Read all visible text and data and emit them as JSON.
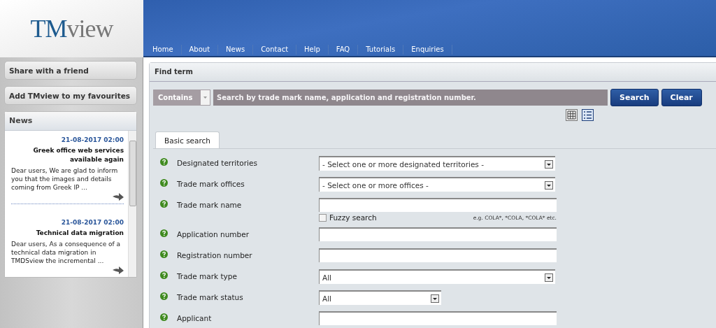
{
  "logo": {
    "part_1": "TM",
    "part_2": "view"
  },
  "nav": [
    "Home",
    "About",
    "News",
    "Contact",
    "Help",
    "FAQ",
    "Tutorials",
    "Enquiries"
  ],
  "sidebar": {
    "buttons": [
      "Share with a friend",
      "Add TMview to my favourites"
    ],
    "news": {
      "title": "News",
      "items": [
        {
          "date": "21-08-2017 02:00",
          "headline": "Greek office web services available again",
          "body": "Dear users, We are glad to inform you that the images and details coming from Greek IP ..."
        },
        {
          "date": "21-08-2017 02:00",
          "headline": "Technical data migration",
          "body": "Dear users, As a consequence of a technical data migration in TMDSview the incremental ..."
        }
      ]
    }
  },
  "find": {
    "title": "Find term",
    "mode": "Contains",
    "placeholder": "Search by trade mark name, application and registration number.",
    "buttons": [
      "Search",
      "Clear"
    ],
    "views": [
      {
        "kind": "grid",
        "selected": false
      },
      {
        "kind": "list",
        "selected": true
      }
    ]
  },
  "tabs": [
    {
      "label": "Basic search",
      "selected": true
    }
  ],
  "fields": [
    {
      "label": "Designated territories",
      "kind": "select",
      "value": "- Select one or more designated territories -"
    },
    {
      "label": "Trade mark offices",
      "kind": "select",
      "value": "- Select one or more offices -"
    },
    {
      "label": "Trade mark name",
      "kind": "text",
      "fuzzy": {
        "label": "Fuzzy search",
        "checked": false
      },
      "hint": "e.g. COLA*, *COLA, *COLA* etc."
    },
    {
      "label": "Application number",
      "kind": "text"
    },
    {
      "label": "Registration number",
      "kind": "text"
    },
    {
      "label": "Trade mark type",
      "kind": "select",
      "value": "All"
    },
    {
      "label": "Trade mark status",
      "kind": "select-short",
      "value": "All"
    },
    {
      "label": "Applicant",
      "kind": "text"
    }
  ]
}
